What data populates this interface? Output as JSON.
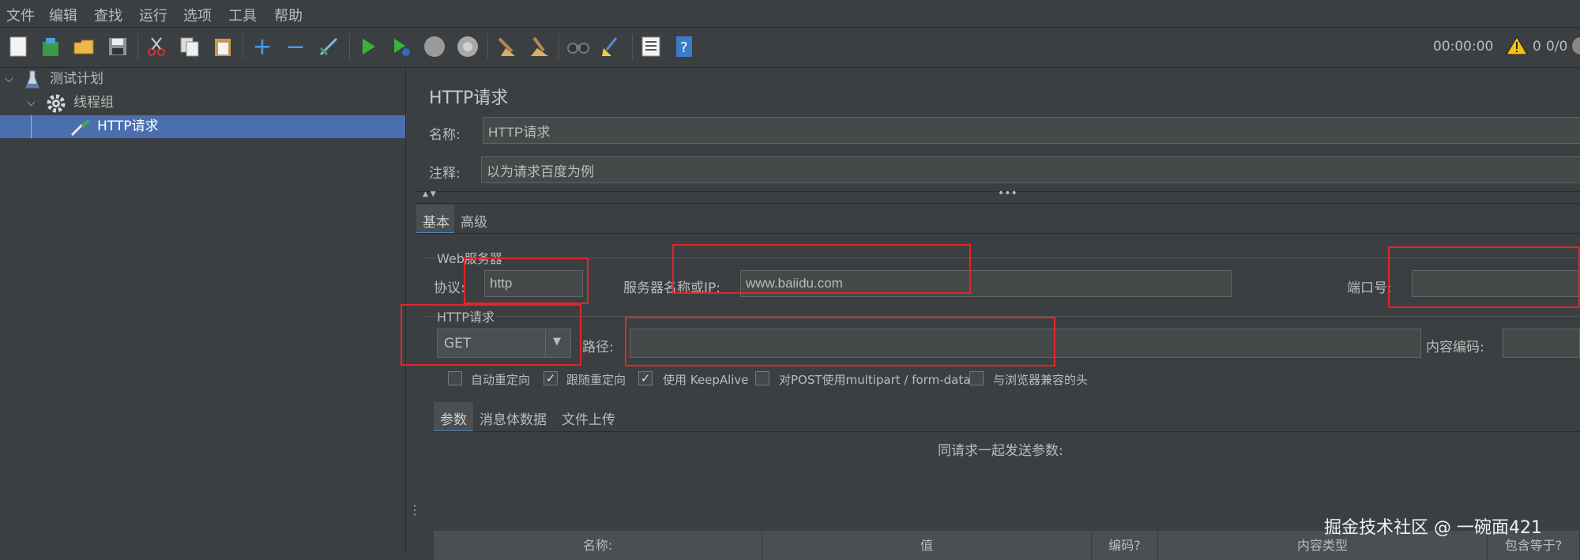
{
  "menu": [
    "文件",
    "编辑",
    "查找",
    "运行",
    "选项",
    "工具",
    "帮助"
  ],
  "status": {
    "timer": "00:00:00",
    "warnings": "0",
    "threads": "0/0"
  },
  "tree": {
    "items": [
      {
        "label": "测试计划",
        "icon": "flask-icon"
      },
      {
        "label": "线程组",
        "icon": "gear-icon"
      },
      {
        "label": "HTTP请求",
        "icon": "pipette-icon"
      }
    ]
  },
  "panel": {
    "title": "HTTP请求",
    "name_label": "名称:",
    "name_value": "HTTP请求",
    "comment_label": "注释:",
    "comment_value": "以为请求百度为例",
    "tabs": [
      "基本",
      "高级"
    ],
    "web_server": {
      "title": "Web服务器",
      "protocol_label": "协议:",
      "protocol_value": "http",
      "server_label": "服务器名称或IP:",
      "server_value": "www.baiidu.com",
      "port_label": "端口号:",
      "port_value": ""
    },
    "http_request": {
      "title": "HTTP请求",
      "method": "GET",
      "path_label": "路径:",
      "path_value": "",
      "encoding_label": "内容编码:",
      "encoding_value": ""
    },
    "options": [
      {
        "label": "自动重定向",
        "checked": false
      },
      {
        "label": "跟随重定向",
        "checked": true
      },
      {
        "label": "使用 KeepAlive",
        "checked": true
      },
      {
        "label": "对POST使用multipart / form-data",
        "checked": false
      },
      {
        "label": "与浏览器兼容的头",
        "checked": false
      }
    ],
    "sub_tabs": [
      "参数",
      "消息体数据",
      "文件上传"
    ],
    "params_caption": "同请求一起发送参数:",
    "table_headers": [
      "名称:",
      "值",
      "编码?",
      "内容类型",
      "包含等于?"
    ]
  },
  "watermark": "掘金技术社区 @ 一碗面421"
}
